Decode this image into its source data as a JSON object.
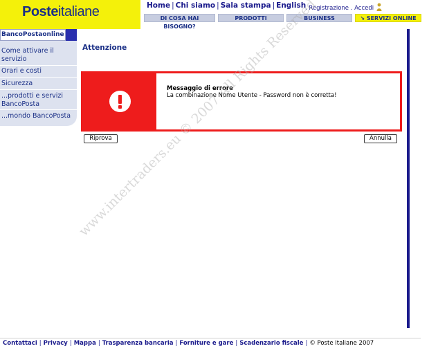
{
  "logo": {
    "part1": "Poste",
    "part2": "italiane"
  },
  "topnav": {
    "home": "Home",
    "chi_siamo": "Chi siamo",
    "sala_stampa": "Sala stampa",
    "english": "English",
    "separator": "|"
  },
  "usernav": {
    "registrazione": ". Registrazione",
    "accedi": ". Accedi"
  },
  "tabs": [
    "DI COSA HAI BISOGNO?",
    "PRODOTTI",
    "BUSINESS",
    "SERVIZI ONLINE"
  ],
  "sidebar": {
    "title": "BancoPostaonline",
    "items": [
      "Come attivare il servizio",
      "Orari e costi",
      "Sicurezza",
      "...prodotti e servizi BancoPosta",
      "...mondo BancoPosta"
    ]
  },
  "main": {
    "title": "Attenzione",
    "error_title": "Messaggio di errore",
    "error_text": "La combinazione Nome Utente - Password non è corretta!",
    "retry_label": "Riprova",
    "cancel_label": "Annulla"
  },
  "footer": {
    "links": [
      "Contattaci",
      "Privacy",
      "Mappa",
      "Trasparenza bancaria",
      "Forniture e gare",
      "Scadenzario fiscale"
    ],
    "copyright": "© Poste Italiane 2007"
  },
  "watermark": "www.intertraders.eu © 2007 All Rights Reserved",
  "colors": {
    "brand_yellow": "#f4f10a",
    "brand_blue": "#1a2f86",
    "error_red": "#ee1c1c"
  }
}
